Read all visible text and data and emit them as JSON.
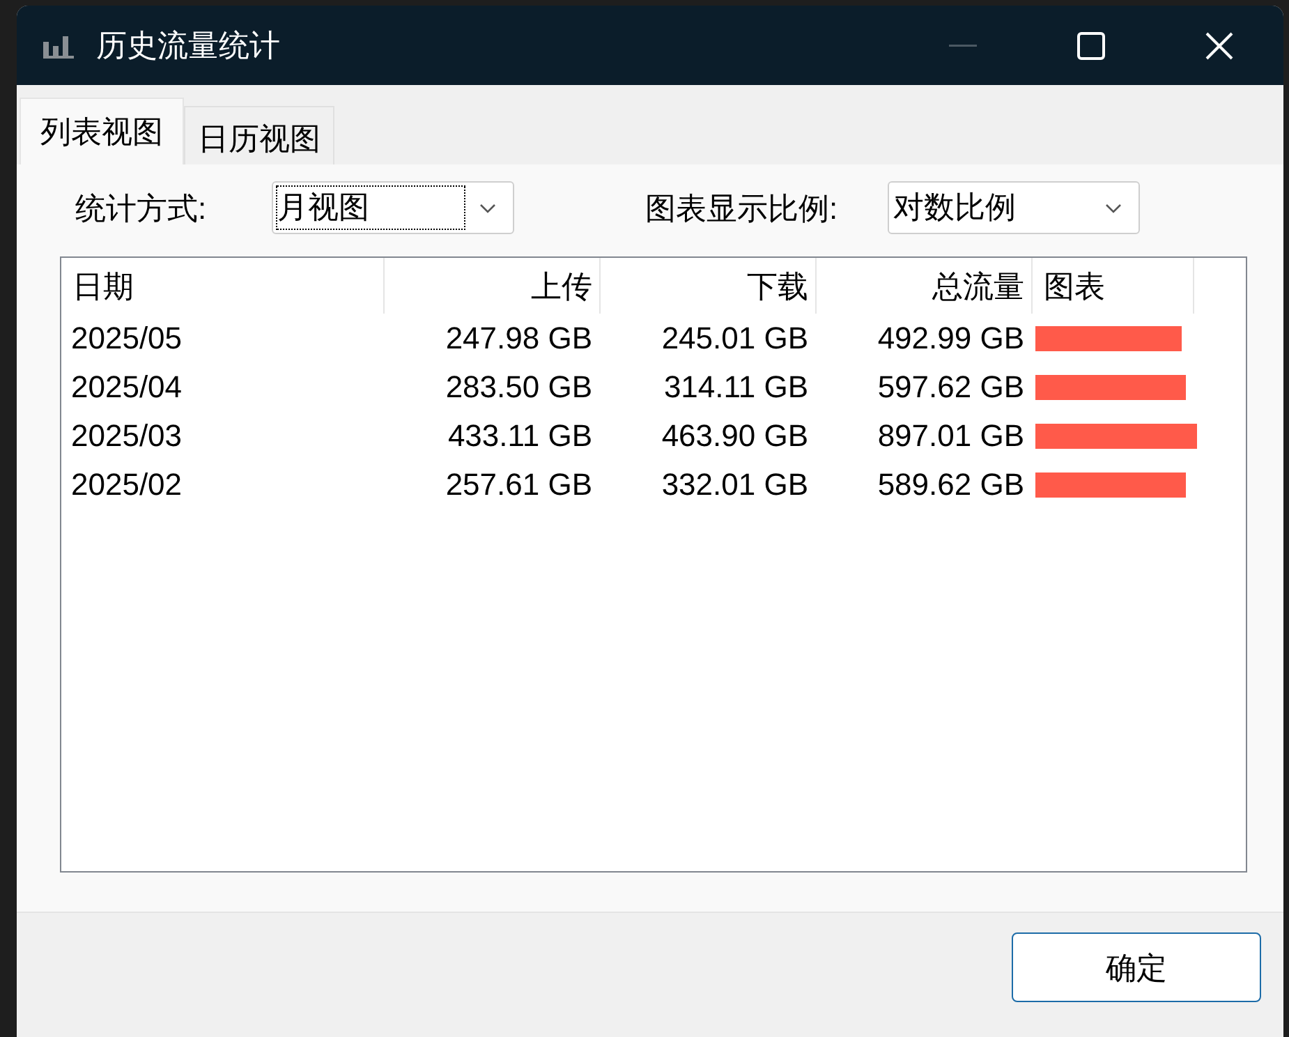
{
  "window": {
    "title": "历史流量统计"
  },
  "tabs": [
    {
      "label": "列表视图",
      "selected": true
    },
    {
      "label": "日历视图",
      "selected": false
    }
  ],
  "filters": [
    {
      "label": "统计方式:",
      "value": "月视图",
      "focused": true
    },
    {
      "label": "图表显示比例:",
      "value": "对数比例",
      "focused": false
    }
  ],
  "table": {
    "columns": [
      "日期",
      "上传",
      "下载",
      "总流量",
      "图表"
    ],
    "rows": [
      {
        "cells": [
          "2025/05",
          "247.98 GB",
          "245.01 GB",
          "492.99 GB"
        ],
        "level": 0.905
      },
      {
        "cells": [
          "2025/04",
          "283.50 GB",
          "314.11 GB",
          "597.62 GB"
        ],
        "level": 0.93
      },
      {
        "cells": [
          "2025/03",
          "433.11 GB",
          "463.90 GB",
          "897.01 GB"
        ],
        "level": 1.0
      },
      {
        "cells": [
          "2025/02",
          "257.61 GB",
          "332.01 GB",
          "589.62 GB"
        ],
        "level": 0.93
      }
    ]
  },
  "buttons": [
    "确定"
  ]
}
